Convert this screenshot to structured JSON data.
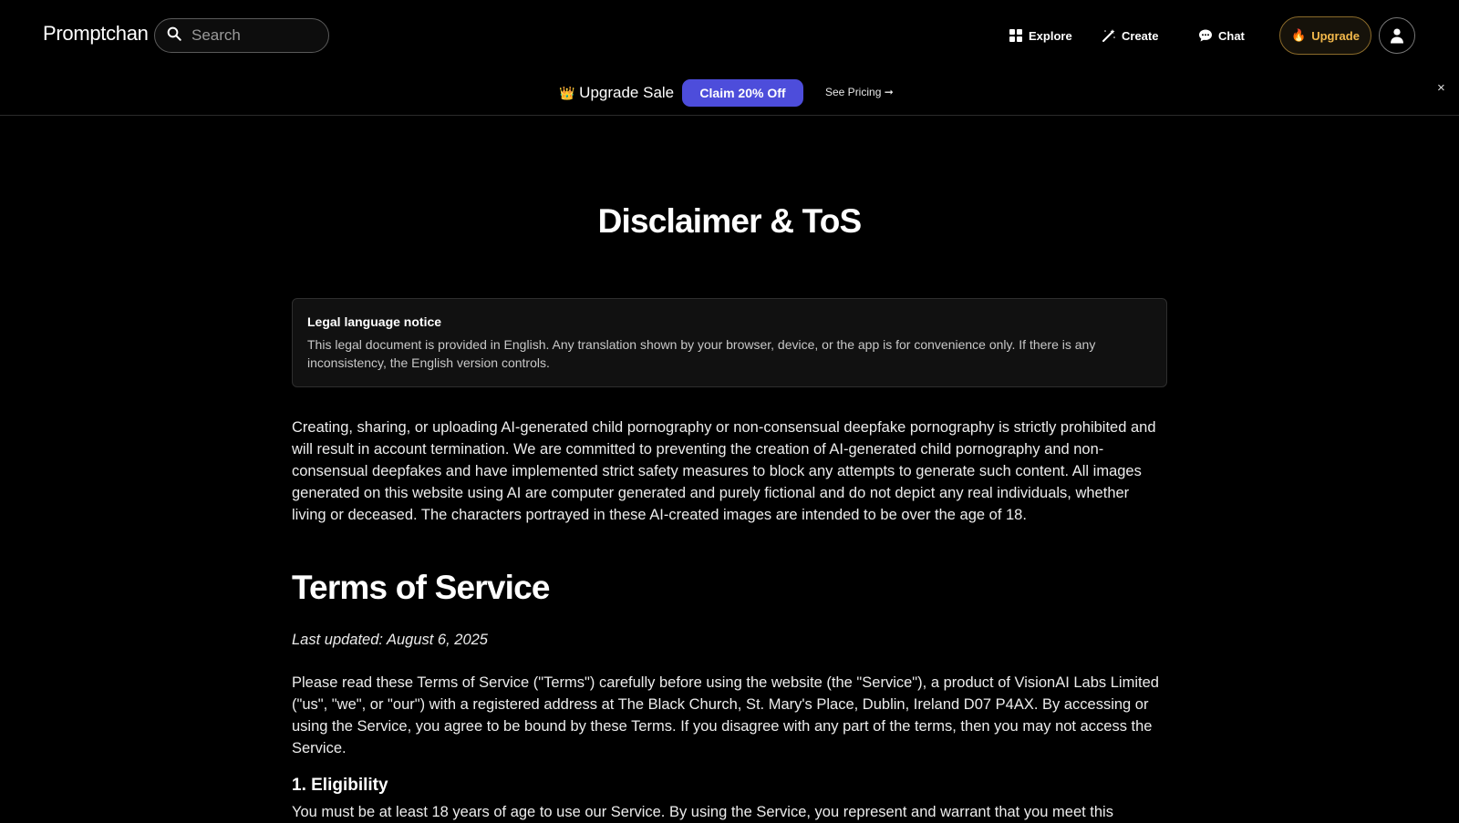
{
  "header": {
    "logo": "Promptchan",
    "search": {
      "placeholder": "Search",
      "value": ""
    },
    "nav": [
      {
        "label": "Explore",
        "icon": "grid-icon"
      },
      {
        "label": "Create",
        "icon": "wand-icon"
      },
      {
        "label": "Chat",
        "icon": "chat-bubble-icon"
      }
    ],
    "upgrade": {
      "label": "Upgrade",
      "icon": "flame-icon"
    },
    "account": {
      "icon": "user-icon"
    }
  },
  "promo": {
    "emoji": "👑",
    "title": "Upgrade Sale",
    "claim_label": "Claim 20% Off",
    "pricing_label": "See Pricing ➞",
    "close_label": "×"
  },
  "main": {
    "title": "Disclaimer & ToS",
    "notice": {
      "title": "Legal language notice",
      "body": "This legal document is provided in English. Any translation shown by your browser, device, or the app is for convenience only. If there is any inconsistency, the English version controls."
    },
    "disclaimer": "Creating, sharing, or uploading AI-generated child pornography or non-consensual deepfake pornography is strictly prohibited and will result in account termination. We are committed to preventing the creation of AI-generated child pornography and non-consensual deepfakes and have implemented strict safety measures to block any attempts to generate such content. All images generated on this website using AI are computer generated and purely fictional and do not depict any real individuals, whether living or deceased. The characters portrayed in these AI-created images are intended to be over the age of 18.",
    "tos_heading": "Terms of Service",
    "last_updated": "Last updated: August 6, 2025",
    "intro": "Please read these Terms of Service (\"Terms\") carefully before using the website (the \"Service\"), a product of VisionAI Labs Limited (\"us\", \"we\", or \"our\") with a registered address at The Black Church, St. Mary's Place, Dublin, Ireland D07 P4AX. By accessing or using the Service, you agree to be bound by these Terms. If you disagree with any part of the terms, then you may not access the Service.",
    "section1": {
      "heading": "1. Eligibility",
      "body": "You must be at least 18 years of age to use our Service. By using the Service, you represent and warrant that you meet this"
    }
  },
  "colors": {
    "background": "#000000",
    "accent": "#4d4ddb",
    "upgrade": "#f2b84b"
  }
}
